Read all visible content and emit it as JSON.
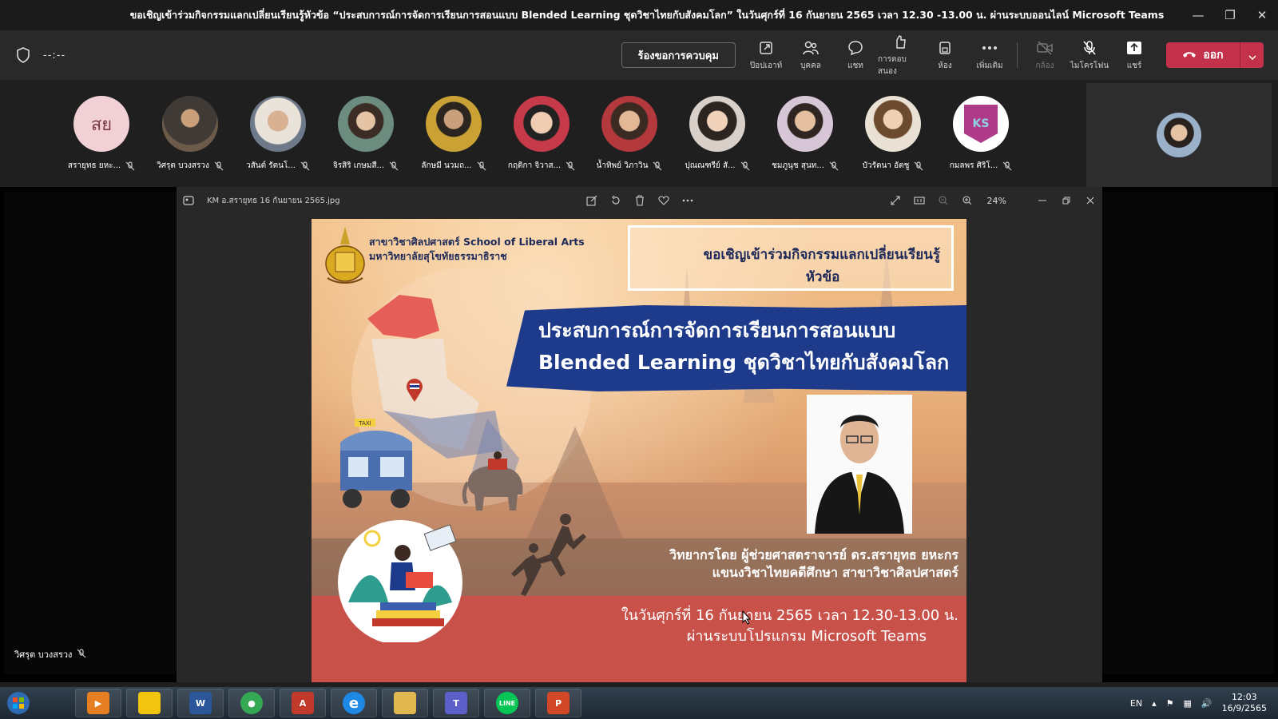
{
  "window": {
    "title": "ขอเชิญเข้าร่วมกิจกรรมแลกเปลี่ยนเรียนรู้หัวข้อ “ประสบการณ์การจัดการเรียนการสอนแบบ Blended Learning ชุดวิชาไทยกับสังคมโลก” ในวันศุกร์ที่ 16 กันยายน 2565 เวลา 12.30 -13.00 น. ผ่านระบบออนไลน์ Microsoft Teams",
    "minimize": "—",
    "restore": "❐",
    "close": "✕"
  },
  "toolbar": {
    "timer": "--:--",
    "request_control": "ร้องขอการควบคุม",
    "tools": [
      {
        "label": "ป๊อปเอาท์",
        "icon": "popout-icon"
      },
      {
        "label": "บุคคล",
        "icon": "people-icon"
      },
      {
        "label": "แชท",
        "icon": "chat-icon"
      },
      {
        "label": "การตอบสนอง",
        "icon": "reactions-icon"
      },
      {
        "label": "ห้อง",
        "icon": "rooms-icon"
      },
      {
        "label": "เพิ่มเติม",
        "icon": "more-icon"
      },
      {
        "label": "กล้อง",
        "icon": "camera-off-icon"
      },
      {
        "label": "ไมโครโฟน",
        "icon": "mic-off-icon"
      },
      {
        "label": "แชร์",
        "icon": "share-icon"
      }
    ],
    "leave": "ออก"
  },
  "participants": [
    {
      "name": "สรายุทธ ยหะ...",
      "initials": "สย"
    },
    {
      "name": "วิศรุต บวงสรวง"
    },
    {
      "name": "วสันต์ รัตนโ..."
    },
    {
      "name": "จิรสิริ เกษมสี..."
    },
    {
      "name": "ลักษมี นวมถ..."
    },
    {
      "name": "กฤติกา จิวาส..."
    },
    {
      "name": "น้ำทิพย์ วิภาวิน"
    },
    {
      "name": "ปุณณฑรีย์ สั..."
    },
    {
      "name": "ชมภูนุช สุนท..."
    },
    {
      "name": "บัวรัตนา อัตชู"
    },
    {
      "name": "กมลพร ศิริโ...",
      "initials": "KS"
    }
  ],
  "stage": {
    "presenter": "วิศรุต บวงสรวง"
  },
  "viewer": {
    "filename": "KM อ.สรายุทธ 16 กันยายน 2565.jpg",
    "zoom": "24%"
  },
  "poster": {
    "school_line1": "สาขาวิชาศิลปศาสตร์ School of Liberal Arts",
    "school_line2": "มหาวิทยาลัยสุโขทัยธรรมาธิราช",
    "invite_line1": "ขอเชิญเข้าร่วมกิจกรรมแลกเปลี่ยนเรียนรู้",
    "invite_line2": "หัวข้อ",
    "topic_line1": "ประสบการณ์การจัดการเรียนการสอนแบบ",
    "topic_line2": "Blended Learning ชุดวิชาไทยกับสังคมโลก",
    "speaker_line1": "วิทยากรโดย ผู้ช่วยศาสตราจารย์ ดร.สรายุทธ ยหะกร",
    "speaker_line2": "แขนงวิชาไทยคดีศึกษา สาขาวิชาศิลปศาสตร์",
    "date_line1": "ในวันศุกร์ที่ 16 กันยายน 2565 เวลา 12.30-13.00 น.",
    "date_line2": "ผ่านระบบโปรแกรม Microsoft Teams",
    "taxi_sign": "TAXI"
  },
  "taskbar": {
    "apps": [
      {
        "name": "media-player",
        "color": "#e67e22",
        "glyph": "▶"
      },
      {
        "name": "sticky-notes",
        "color": "#f1c40f",
        "glyph": ""
      },
      {
        "name": "word",
        "color": "#2b579a",
        "glyph": "W"
      },
      {
        "name": "chrome",
        "color": "#34a853",
        "glyph": "●"
      },
      {
        "name": "acrobat",
        "color": "#c0392b",
        "glyph": "A"
      },
      {
        "name": "internet-explorer",
        "color": "#1e88e5",
        "glyph": "e"
      },
      {
        "name": "file-explorer",
        "color": "#e0b84f",
        "glyph": ""
      },
      {
        "name": "teams",
        "color": "#5b5fc7",
        "glyph": "T"
      },
      {
        "name": "line",
        "color": "#06c755",
        "glyph": "LINE"
      },
      {
        "name": "powerpoint",
        "color": "#d24726",
        "glyph": "P"
      }
    ],
    "language": "EN",
    "time": "12:03",
    "date": "16/9/2565"
  }
}
